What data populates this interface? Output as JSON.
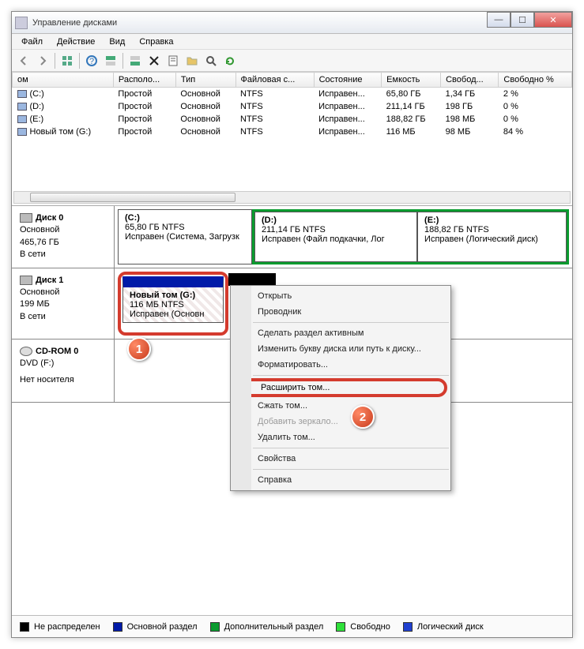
{
  "window": {
    "title": "Управление дисками"
  },
  "menubar": [
    "Файл",
    "Действие",
    "Вид",
    "Справка"
  ],
  "columns": [
    "ом",
    "Располо...",
    "Тип",
    "Файловая с...",
    "Состояние",
    "Емкость",
    "Свобод...",
    "Свободно %"
  ],
  "rows": [
    {
      "name": "(C:)",
      "layout": "Простой",
      "type": "Основной",
      "fs": "NTFS",
      "status": "Исправен...",
      "cap": "65,80 ГБ",
      "free": "1,34 ГБ",
      "pct": "2 %"
    },
    {
      "name": "(D:)",
      "layout": "Простой",
      "type": "Основной",
      "fs": "NTFS",
      "status": "Исправен...",
      "cap": "211,14 ГБ",
      "free": "198 ГБ",
      "pct": "0 %"
    },
    {
      "name": "(E:)",
      "layout": "Простой",
      "type": "Основной",
      "fs": "NTFS",
      "status": "Исправен...",
      "cap": "188,82 ГБ",
      "free": "198 МБ",
      "pct": "0 %"
    },
    {
      "name": "Новый том (G:)",
      "layout": "Простой",
      "type": "Основной",
      "fs": "NTFS",
      "status": "Исправен...",
      "cap": "116 МБ",
      "free": "98 МБ",
      "pct": "84 %"
    }
  ],
  "disk0": {
    "name": "Диск 0",
    "type": "Основной",
    "size": "465,76 ГБ",
    "status": "В сети",
    "parts": [
      {
        "name": "(C:)",
        "line2": "65,80 ГБ NTFS",
        "line3": "Исправен (Система, Загрузк"
      },
      {
        "name": "(D:)",
        "line2": "211,14 ГБ NTFS",
        "line3": "Исправен (Файл подкачки, Лог"
      },
      {
        "name": "(E:)",
        "line2": "188,82 ГБ NTFS",
        "line3": "Исправен (Логический диск)"
      }
    ]
  },
  "disk1": {
    "name": "Диск 1",
    "type": "Основной",
    "size": "199 МБ",
    "status": "В сети",
    "part": {
      "name": "Новый том  (G:)",
      "line2": "116 МБ NTFS",
      "line3": "Исправен (Основн"
    }
  },
  "cdrom": {
    "name": "CD-ROM 0",
    "line2": "DVD (F:)",
    "line3": "Нет носителя"
  },
  "context": {
    "open": "Открыть",
    "explorer": "Проводник",
    "active": "Сделать раздел активным",
    "changeletter": "Изменить букву диска или путь к диску...",
    "format": "Форматировать...",
    "extend": "Расширить том...",
    "shrink": "Сжать том...",
    "mirror": "Добавить зеркало...",
    "delete": "Удалить том...",
    "props": "Свойства",
    "help": "Справка"
  },
  "legend": {
    "unalloc": "Не распределен",
    "primary": "Основной раздел",
    "extended": "Дополнительный раздел",
    "free": "Свободно",
    "logical": "Логический диск"
  },
  "badges": {
    "one": "1",
    "two": "2"
  }
}
